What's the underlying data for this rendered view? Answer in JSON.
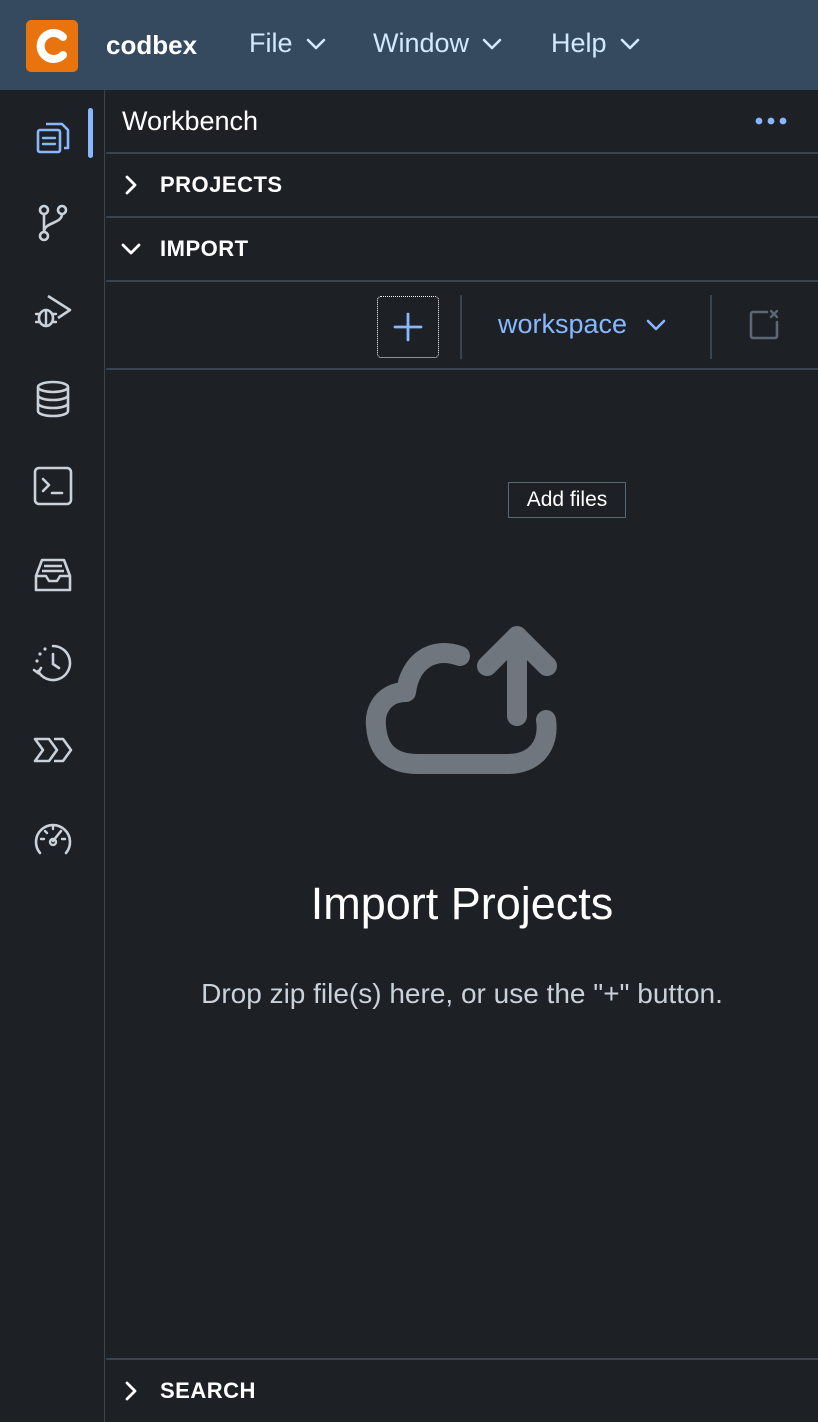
{
  "header": {
    "brand": "codbex",
    "menus": [
      {
        "label": "File"
      },
      {
        "label": "Window"
      },
      {
        "label": "Help"
      }
    ]
  },
  "activity_bar": {
    "items": [
      {
        "icon": "workbench-files-icon",
        "active": true
      },
      {
        "icon": "git-branch-icon"
      },
      {
        "icon": "debug-icon"
      },
      {
        "icon": "database-icon"
      },
      {
        "icon": "terminal-icon"
      },
      {
        "icon": "inbox-icon"
      },
      {
        "icon": "history-icon"
      },
      {
        "icon": "process-icon"
      },
      {
        "icon": "performance-gauge-icon"
      }
    ]
  },
  "panel": {
    "title": "Workbench",
    "sections": {
      "projects": "PROJECTS",
      "import": "IMPORT",
      "search": "SEARCH"
    },
    "toolbar": {
      "workspace": "workspace"
    },
    "tooltip": "Add files",
    "import_title": "Import Projects",
    "import_hint": "Drop zip file(s) here, or use the \"+\" button."
  },
  "colors": {
    "header_bg": "#354a5f",
    "panel_bg": "#1d2025",
    "accent": "#89b7ff",
    "logo": "#e9730c"
  }
}
